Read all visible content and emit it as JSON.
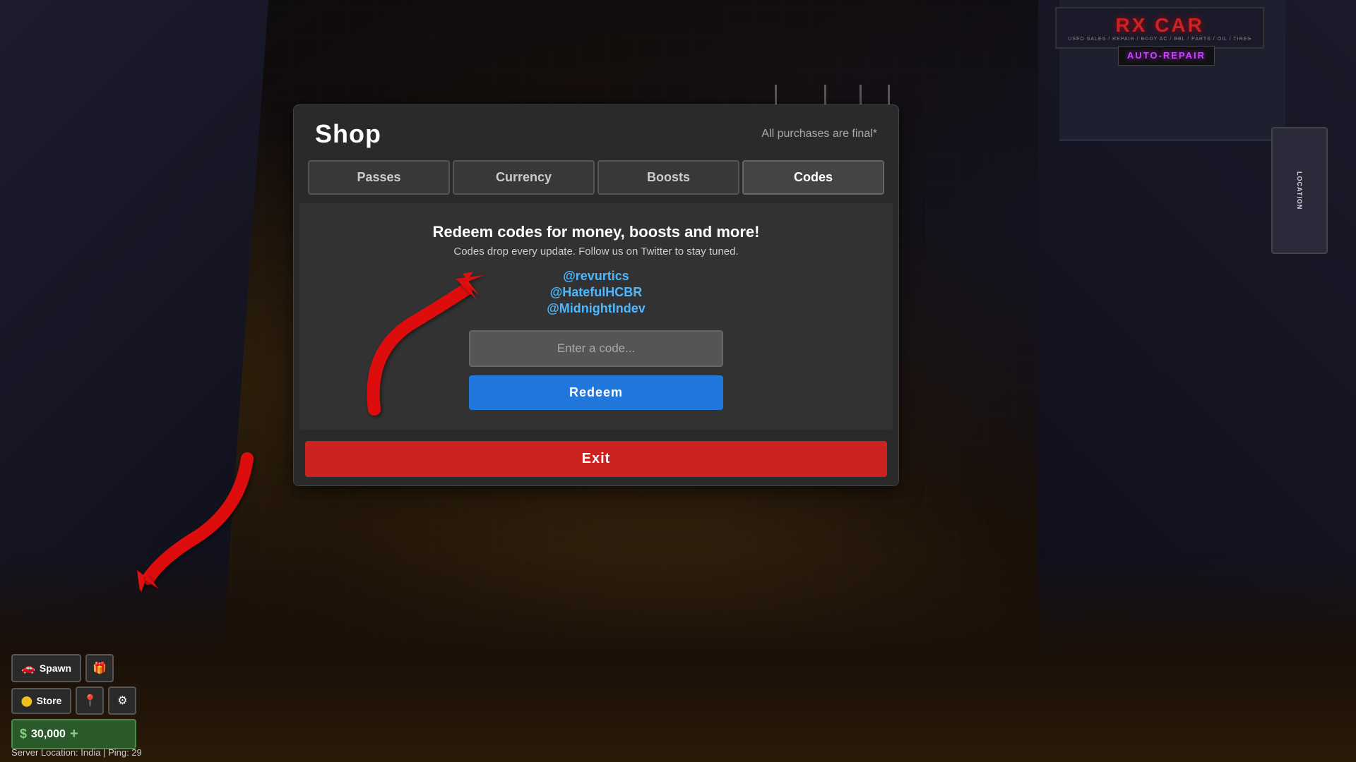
{
  "game": {
    "bg_sign_rx": "RX CAR",
    "bg_sign_rx_sub": "USED SALES / REPAIR / BODY AC / BBL / PARTS / OIL / TIRES",
    "bg_sign_auto_repair": "AUTO-REPAIR",
    "location_label": "LOCATION"
  },
  "shop": {
    "title": "Shop",
    "subtitle": "All purchases are final*",
    "tabs": [
      {
        "label": "Passes",
        "active": false
      },
      {
        "label": "Currency",
        "active": false
      },
      {
        "label": "Boosts",
        "active": false
      },
      {
        "label": "Codes",
        "active": true
      }
    ],
    "active_tab": "Codes",
    "codes_section": {
      "heading": "Redeem codes for money, boosts and more!",
      "subheading": "Codes drop every update. Follow us on Twitter to stay tuned.",
      "twitter_accounts": [
        "@revurtics",
        "@HatefulHCBR",
        "@MidnightIndev"
      ],
      "input_placeholder": "Enter a code...",
      "redeem_label": "Redeem",
      "exit_label": "Exit"
    }
  },
  "hud": {
    "spawn_label": "Spawn",
    "store_label": "Store",
    "money_symbol": "$",
    "money_amount": "30,000",
    "money_add": "+",
    "spawn_icon": "🚗",
    "gift_icon": "🎁",
    "coin_icon": "⬤",
    "location_icon": "📍",
    "gear_icon": "⚙"
  },
  "server": {
    "label": "Server Location:  India | Ping: 29"
  },
  "colors": {
    "accent_blue": "#2277dd",
    "accent_red": "#cc2222",
    "twitter_blue": "#4db8ff",
    "money_green": "#2a5a2a",
    "rx_red": "#cc2222",
    "auto_repair_purple": "#cc44ff"
  }
}
